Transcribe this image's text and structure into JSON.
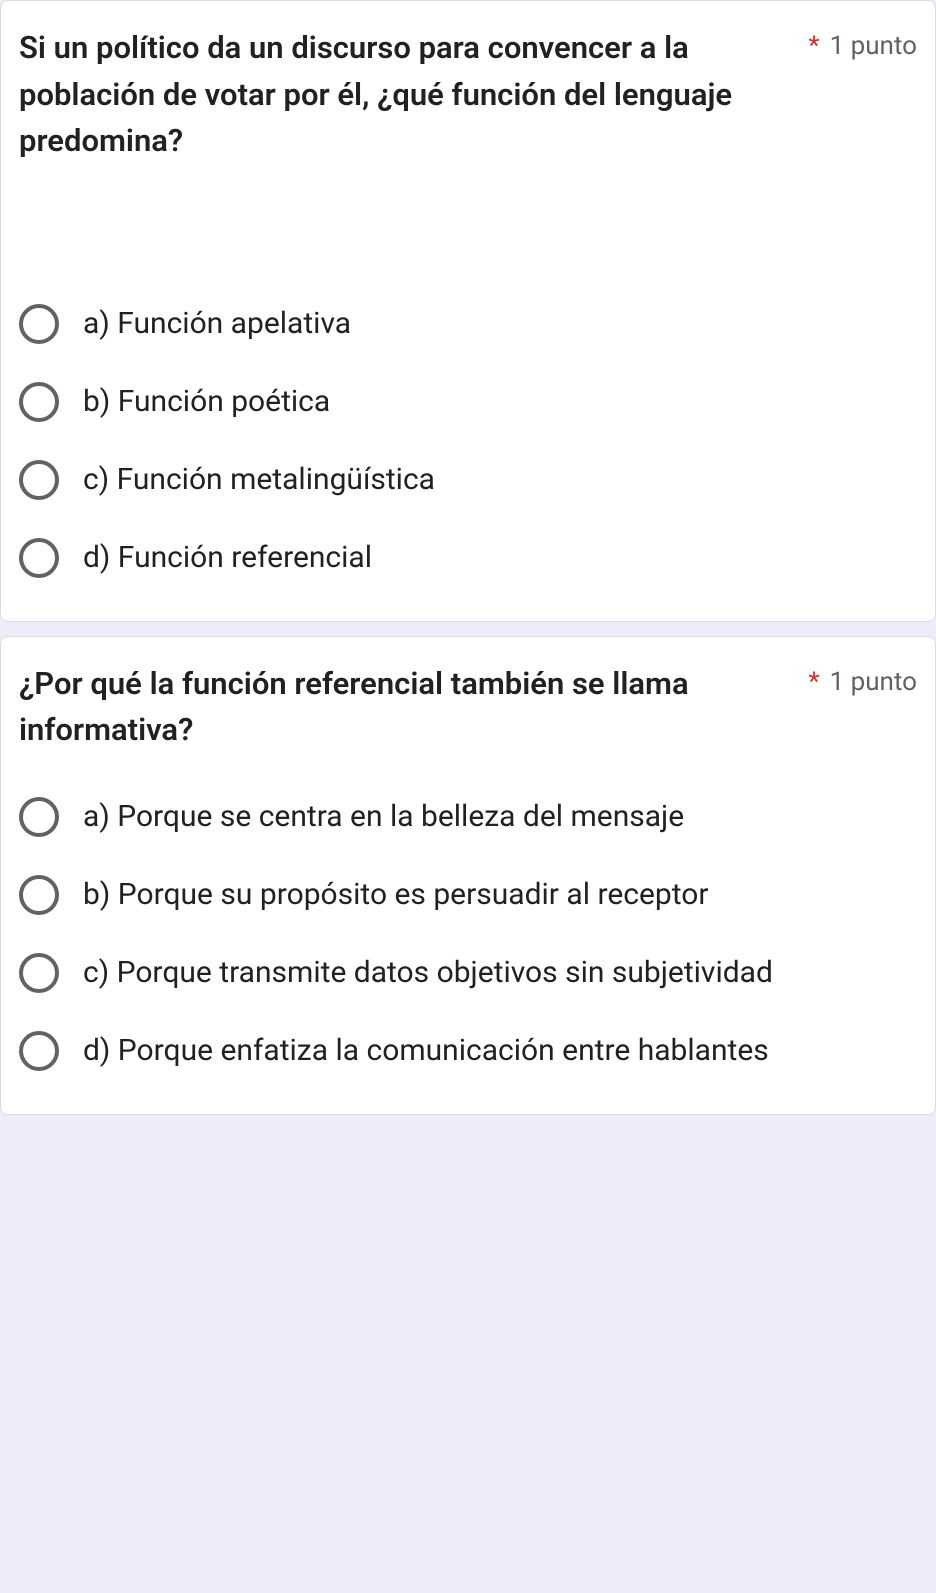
{
  "questions": [
    {
      "title": "Si un político da un discurso para convencer a la población de votar por él, ¿qué función del lenguaje predomina?",
      "required_mark": "*",
      "points": "1 punto",
      "options": [
        "a) Función apelativa",
        "b) Función poética",
        "c) Función metalingüística",
        "d) Función referencial"
      ]
    },
    {
      "title": "¿Por qué la función referencial también se llama informativa?",
      "required_mark": "*",
      "points": "1 punto",
      "options": [
        "a) Porque se centra en la belleza del mensaje",
        "b) Porque su propósito es persuadir al receptor",
        "c) Porque transmite datos objetivos sin subjetividad",
        "d) Porque enfatiza la comunicación entre hablantes"
      ]
    }
  ]
}
